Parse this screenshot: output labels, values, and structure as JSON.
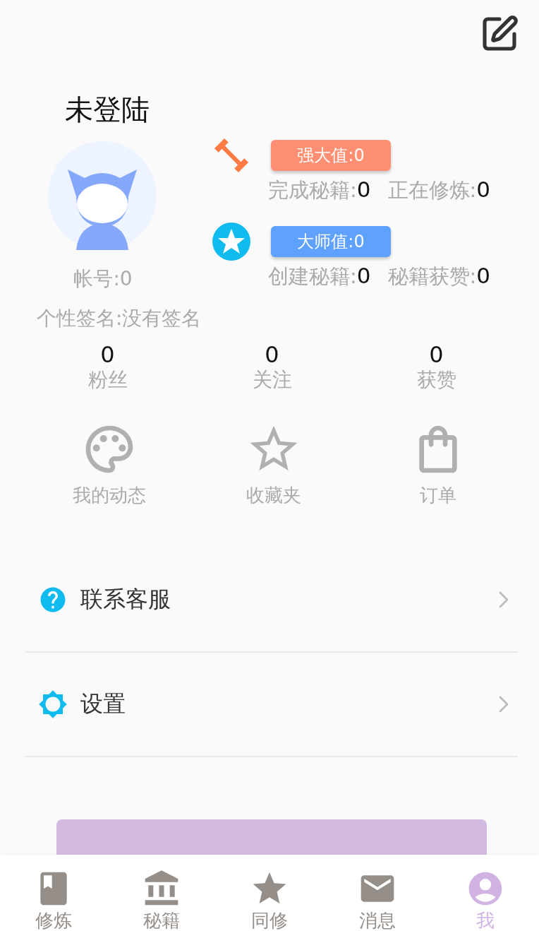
{
  "header": {
    "title": "未登陆"
  },
  "profile": {
    "account": "帐号:0",
    "signature": "个性签名:没有签名"
  },
  "ratings": [
    {
      "kind": "strength",
      "badge": "强大值:0",
      "color": "#ff8f73",
      "stats": [
        {
          "label": "完成秘籍:",
          "value": "0"
        },
        {
          "label": "正在修炼:",
          "value": "0"
        }
      ]
    },
    {
      "kind": "master",
      "badge": "大师值:0",
      "color": "#5ea1ff",
      "stats": [
        {
          "label": "创建秘籍:",
          "value": "0"
        },
        {
          "label": "秘籍获赞:",
          "value": "0"
        }
      ]
    }
  ],
  "counts": [
    {
      "value": "0",
      "label": "粉丝"
    },
    {
      "value": "0",
      "label": "关注"
    },
    {
      "value": "0",
      "label": "获赞"
    }
  ],
  "shortcuts": [
    {
      "kind": "palette",
      "label": "我的动态"
    },
    {
      "kind": "star",
      "label": "收藏夹"
    },
    {
      "kind": "bag",
      "label": "订单"
    }
  ],
  "menu": [
    {
      "kind": "help",
      "label": "联系客服"
    },
    {
      "kind": "settings",
      "label": "设置"
    }
  ],
  "nav": [
    {
      "kind": "book",
      "label": "修炼",
      "selected": false
    },
    {
      "kind": "bank",
      "label": "秘籍",
      "selected": false
    },
    {
      "kind": "star",
      "label": "同修",
      "selected": false
    },
    {
      "kind": "mail",
      "label": "消息",
      "selected": false
    },
    {
      "kind": "person",
      "label": "我",
      "selected": true
    }
  ]
}
